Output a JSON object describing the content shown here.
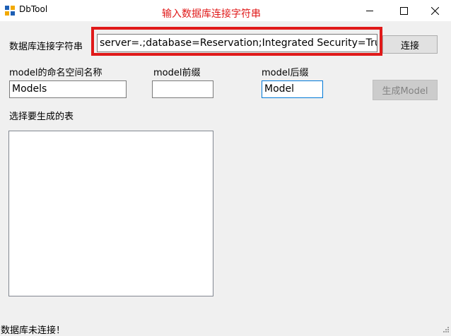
{
  "window": {
    "title": "DbTool",
    "annotation": "输入数据库连接字符串"
  },
  "form": {
    "connection_label": "数据库连接字符串",
    "connection_value": "server=.;database=Reservation;Integrated Security=True;",
    "connect_button": "连接",
    "namespace_label": "model的命名空间名称",
    "namespace_value": "Models",
    "prefix_label": "model前缀",
    "prefix_value": "",
    "suffix_label": "model后缀",
    "suffix_value": "Model",
    "generate_button": "生成Model",
    "tables_label": "选择要生成的表",
    "tables": []
  },
  "status": {
    "text": "数据库未连接！"
  },
  "colors": {
    "annotation": "#e01919",
    "focus_border": "#0078d7"
  },
  "icons": [
    "app-icon",
    "minimize-icon",
    "maximize-icon",
    "close-icon",
    "size-grip-icon"
  ]
}
